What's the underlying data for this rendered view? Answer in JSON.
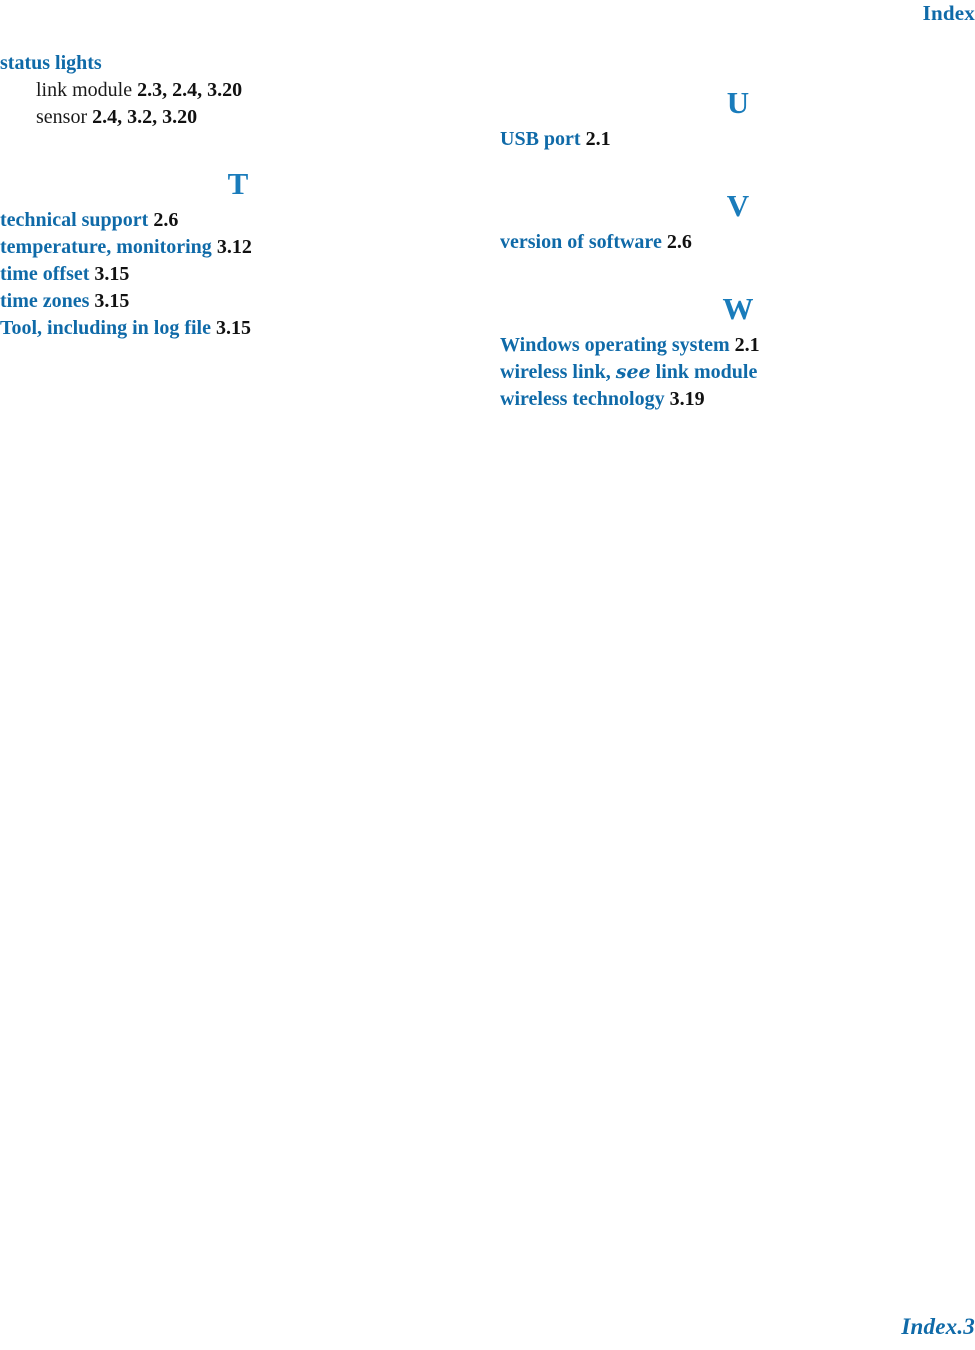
{
  "header": {
    "title": "Index"
  },
  "footer": {
    "page_label": "Index.3"
  },
  "colors": {
    "entry_blue": "#0f6aa8",
    "letter_blue": "#1a7cbb",
    "pageref_black": "#111111",
    "subentry_black": "#1a1a1a",
    "page_background": "#ffffff"
  },
  "columns": {
    "left": {
      "groups": [
        {
          "letter": null,
          "entries": [
            {
              "level": 1,
              "term": "status lights",
              "pages": ""
            },
            {
              "level": 2,
              "term": "link module",
              "pages": "2.3, 2.4, 3.20"
            },
            {
              "level": 2,
              "term": "sensor",
              "pages": "2.4, 3.2, 3.20"
            }
          ]
        },
        {
          "letter": "T",
          "entries": [
            {
              "level": 1,
              "term": "technical support",
              "pages": "2.6"
            },
            {
              "level": 1,
              "term": "temperature, monitoring",
              "pages": "3.12"
            },
            {
              "level": 1,
              "term": "time offset",
              "pages": "3.15"
            },
            {
              "level": 1,
              "term": "time zones",
              "pages": "3.15"
            },
            {
              "level": 1,
              "term": "Tool, including in log file",
              "pages": "3.15"
            }
          ]
        }
      ]
    },
    "right": {
      "groups": [
        {
          "letter": "U",
          "entries": [
            {
              "level": 1,
              "term": "USB port",
              "pages": "2.1"
            }
          ]
        },
        {
          "letter": "V",
          "entries": [
            {
              "level": 1,
              "term": "version of software",
              "pages": "2.6"
            }
          ]
        },
        {
          "letter": "W",
          "entries": [
            {
              "level": 1,
              "term": "Windows operating system",
              "pages": "2.1"
            },
            {
              "level": 1,
              "term": "wireless link,",
              "cross_reference": "see",
              "cross_target": "link module",
              "pages": ""
            },
            {
              "level": 1,
              "term": "wireless technology",
              "pages": "3.19"
            }
          ]
        }
      ]
    }
  }
}
